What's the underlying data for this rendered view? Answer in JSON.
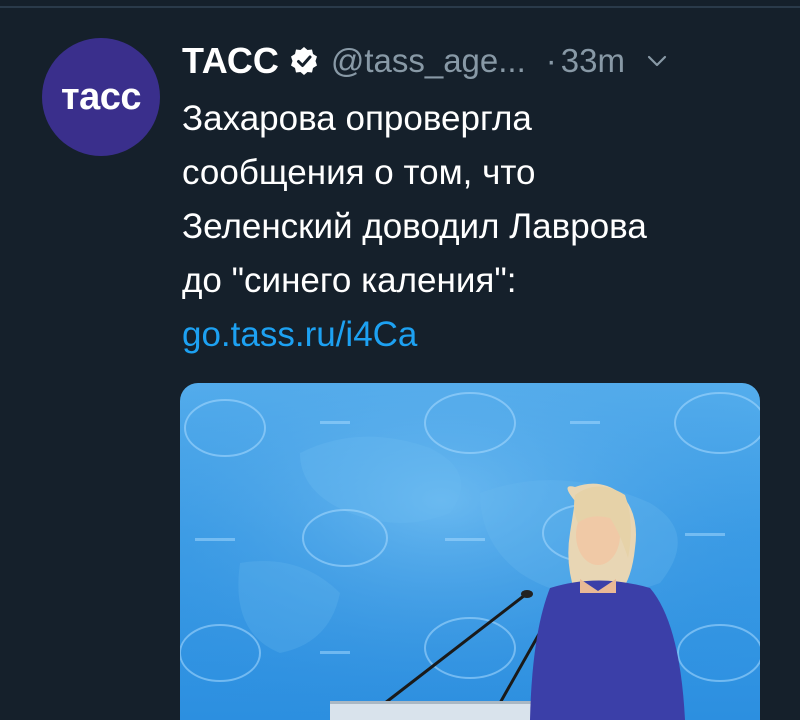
{
  "tweet": {
    "author_name": "ТАСС",
    "handle": "@tass_age...",
    "separator": "·",
    "time": "33m",
    "avatar_text": "тасс",
    "text_lines": [
      "Захарова опровергла",
      "сообщения о том, что",
      "Зеленский доводил Лаврова",
      "до \"синего каления\":"
    ],
    "link": "go.tass.ru/i4Ca"
  },
  "icons": {
    "verified": "verified-badge-icon",
    "chevron": "chevron-down-icon"
  },
  "colors": {
    "background": "#15202b",
    "link": "#1da1f2",
    "muted": "#8899a6",
    "avatar": "#3a2f8c",
    "media_blue": "#3a9ce6"
  }
}
